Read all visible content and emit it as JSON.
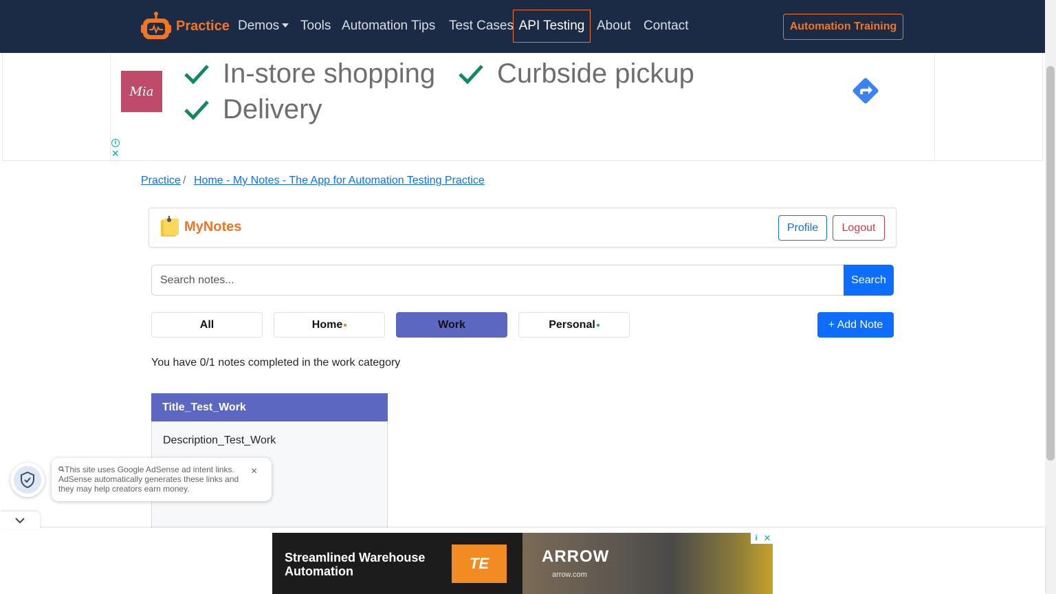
{
  "navbar": {
    "brand": "Practice",
    "links": [
      "Demos",
      "Tools",
      "Automation Tips",
      "Test Cases",
      "API Testing",
      "About",
      "Contact"
    ],
    "training_button": "Automation Training",
    "accent": "#f47521",
    "background": "#1b2b45"
  },
  "ad_top": {
    "brand_logo_text": "Mia",
    "items": [
      "In-store shopping",
      "Curbside pickup",
      "Delivery"
    ],
    "info_icon": "info-icon",
    "close_icon": "close-icon"
  },
  "breadcrumb": {
    "items": [
      "Practice",
      "Home - My Notes - The App for Automation Testing Practice"
    ],
    "separator": "/"
  },
  "app": {
    "title": "MyNotes",
    "profile_button": "Profile",
    "logout_button": "Logout"
  },
  "search": {
    "placeholder": "Search notes...",
    "button": "Search"
  },
  "categories": {
    "tabs": [
      "All",
      "Home",
      "Work",
      "Personal"
    ],
    "active": "Work",
    "active_color": "#5c67c2",
    "add_button": "+ Add Note"
  },
  "progress_text": "You have 0/1 notes completed in the work category",
  "notes": [
    {
      "title": "Title_Test_Work",
      "description": "Description_Test_Work"
    }
  ],
  "adsense_popup": {
    "text": "This site uses Google AdSense ad intent links. AdSense automatically generates these links and they may help creators earn money.",
    "close": "×"
  },
  "ad_bottom": {
    "headline": "Streamlined Warehouse Automation",
    "te_logo": "TE",
    "arrow_logo": "ARROW",
    "arrow_url": "arrow.com"
  }
}
